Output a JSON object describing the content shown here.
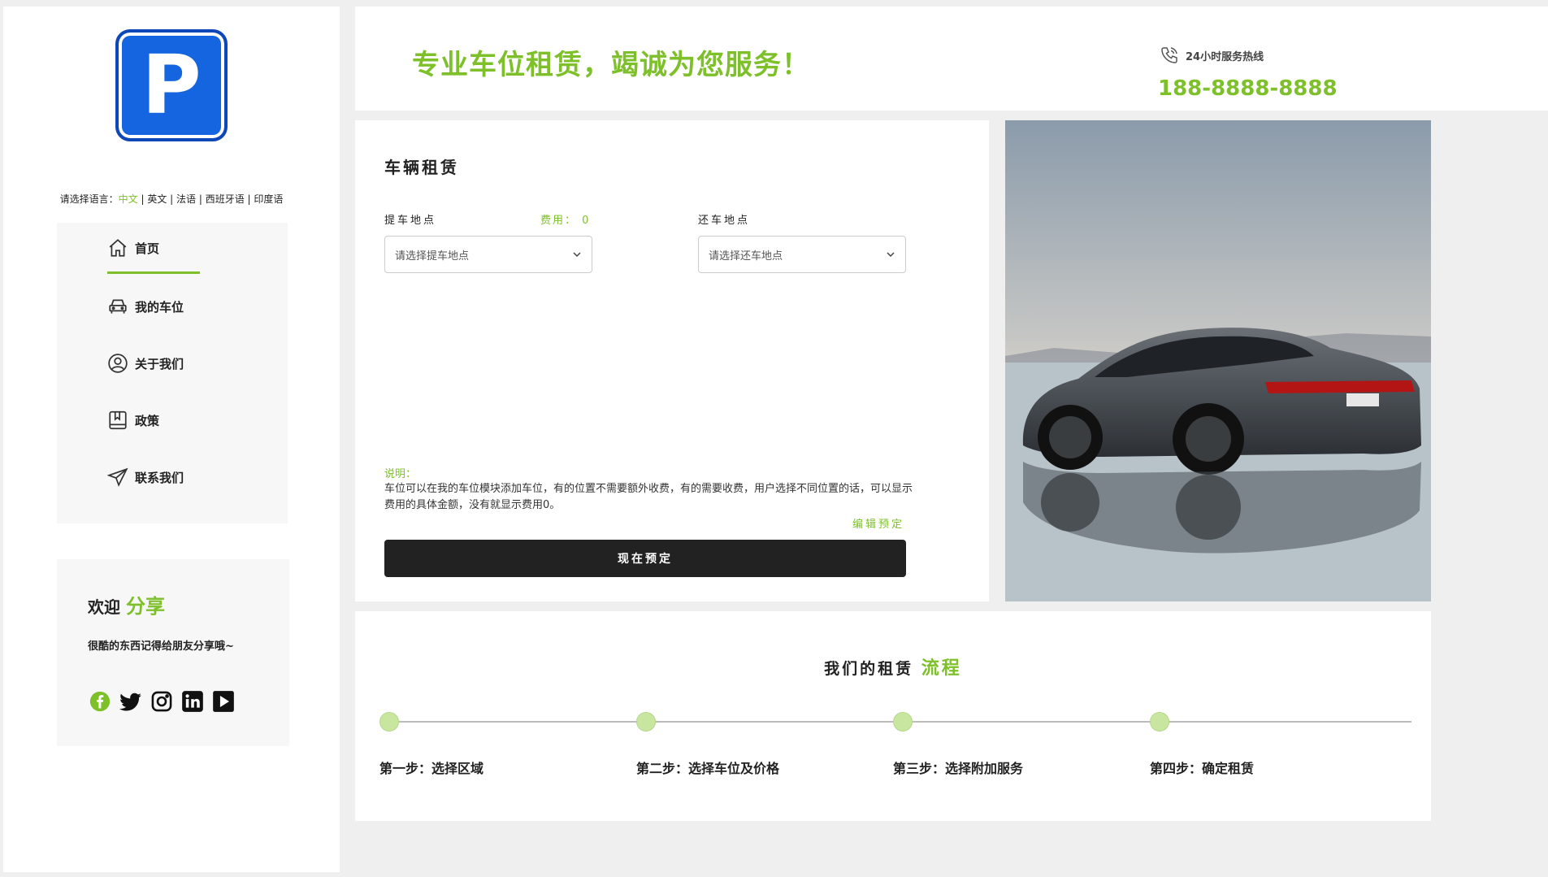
{
  "sidebar": {
    "logo_letter": "P",
    "language": {
      "prompt": "请选择语言：",
      "current": "中文",
      "options": [
        "英文",
        "法语",
        "西班牙语",
        "印度语"
      ]
    },
    "nav": [
      {
        "label": "首页",
        "icon": "home-icon",
        "active": true
      },
      {
        "label": "我的车位",
        "icon": "car-icon"
      },
      {
        "label": "关于我们",
        "icon": "user-icon"
      },
      {
        "label": "政策",
        "icon": "book-icon"
      },
      {
        "label": "联系我们",
        "icon": "send-icon"
      }
    ],
    "share": {
      "title_prefix": "欢迎 ",
      "title_accent": "分享",
      "subtitle": "很酷的东西记得给朋友分享哦~",
      "icons": [
        "facebook-icon",
        "twitter-icon",
        "instagram-icon",
        "linkedin-icon",
        "youtube-icon"
      ]
    }
  },
  "header": {
    "slogan": "专业车位租赁，竭诚为您服务！",
    "hotline_label": "24小时服务热线",
    "hotline_number": "188-8888-8888"
  },
  "booking": {
    "title": "车辆租赁",
    "pickup_label": "提车地点",
    "fee_label": "费用： 0",
    "return_label": "还车地点",
    "pickup_placeholder": "请选择提车地点",
    "return_placeholder": "请选择还车地点",
    "note_label": "说明：",
    "note_text": "车位可以在我的车位模块添加车位，有的位置不需要额外收费，有的需要收费，用户选择不同位置的话，可以显示费用的具体金额，没有就显示费用0。",
    "edit_link": "编辑预定",
    "book_button": "现在预定"
  },
  "process": {
    "title_prefix": "我们的租赁 ",
    "title_accent": "流程",
    "steps": [
      "第一步：选择区域",
      "第二步：选择车位及价格",
      "第三步：选择附加服务",
      "第四步：确定租赁"
    ]
  },
  "colors": {
    "accent": "#7dc02a",
    "dark": "#222222",
    "logo_blue": "#1565e0"
  }
}
